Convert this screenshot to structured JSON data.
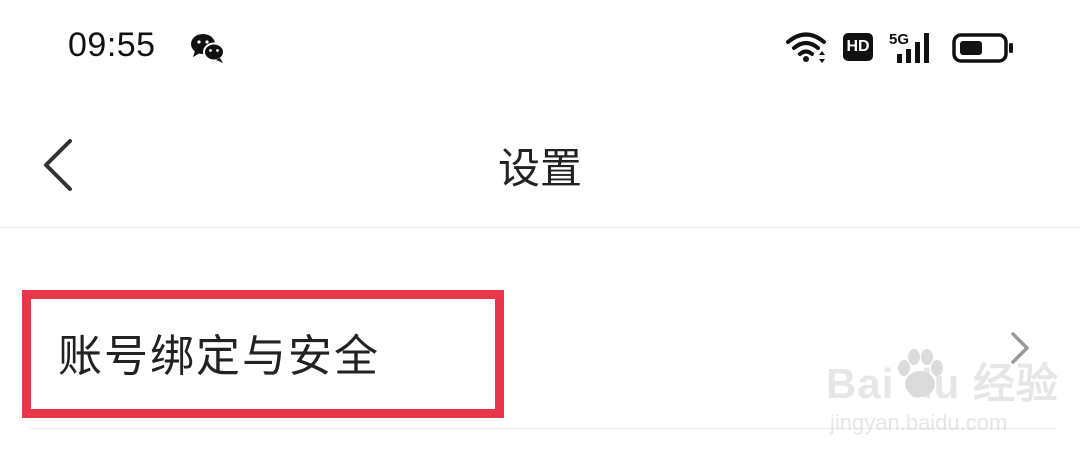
{
  "status_bar": {
    "time": "09:55",
    "hd_badge": "HD",
    "network": "5G",
    "icons": [
      "wechat-icon",
      "wifi-icon",
      "hd-icon",
      "signal-icon",
      "battery-icon"
    ]
  },
  "nav": {
    "title": "设置",
    "back_icon": "back-chevron-icon"
  },
  "settings": {
    "items": [
      {
        "label": "账号绑定与安全",
        "icon": "chevron-right-icon",
        "highlighted": true
      }
    ]
  },
  "watermark": {
    "brand": "Bai  du 经验",
    "url": "jingyan.baidu.com"
  },
  "colors": {
    "highlight": "#e8364a",
    "text": "#222222",
    "divider": "#ececec",
    "chevron": "#9a9a9a"
  }
}
